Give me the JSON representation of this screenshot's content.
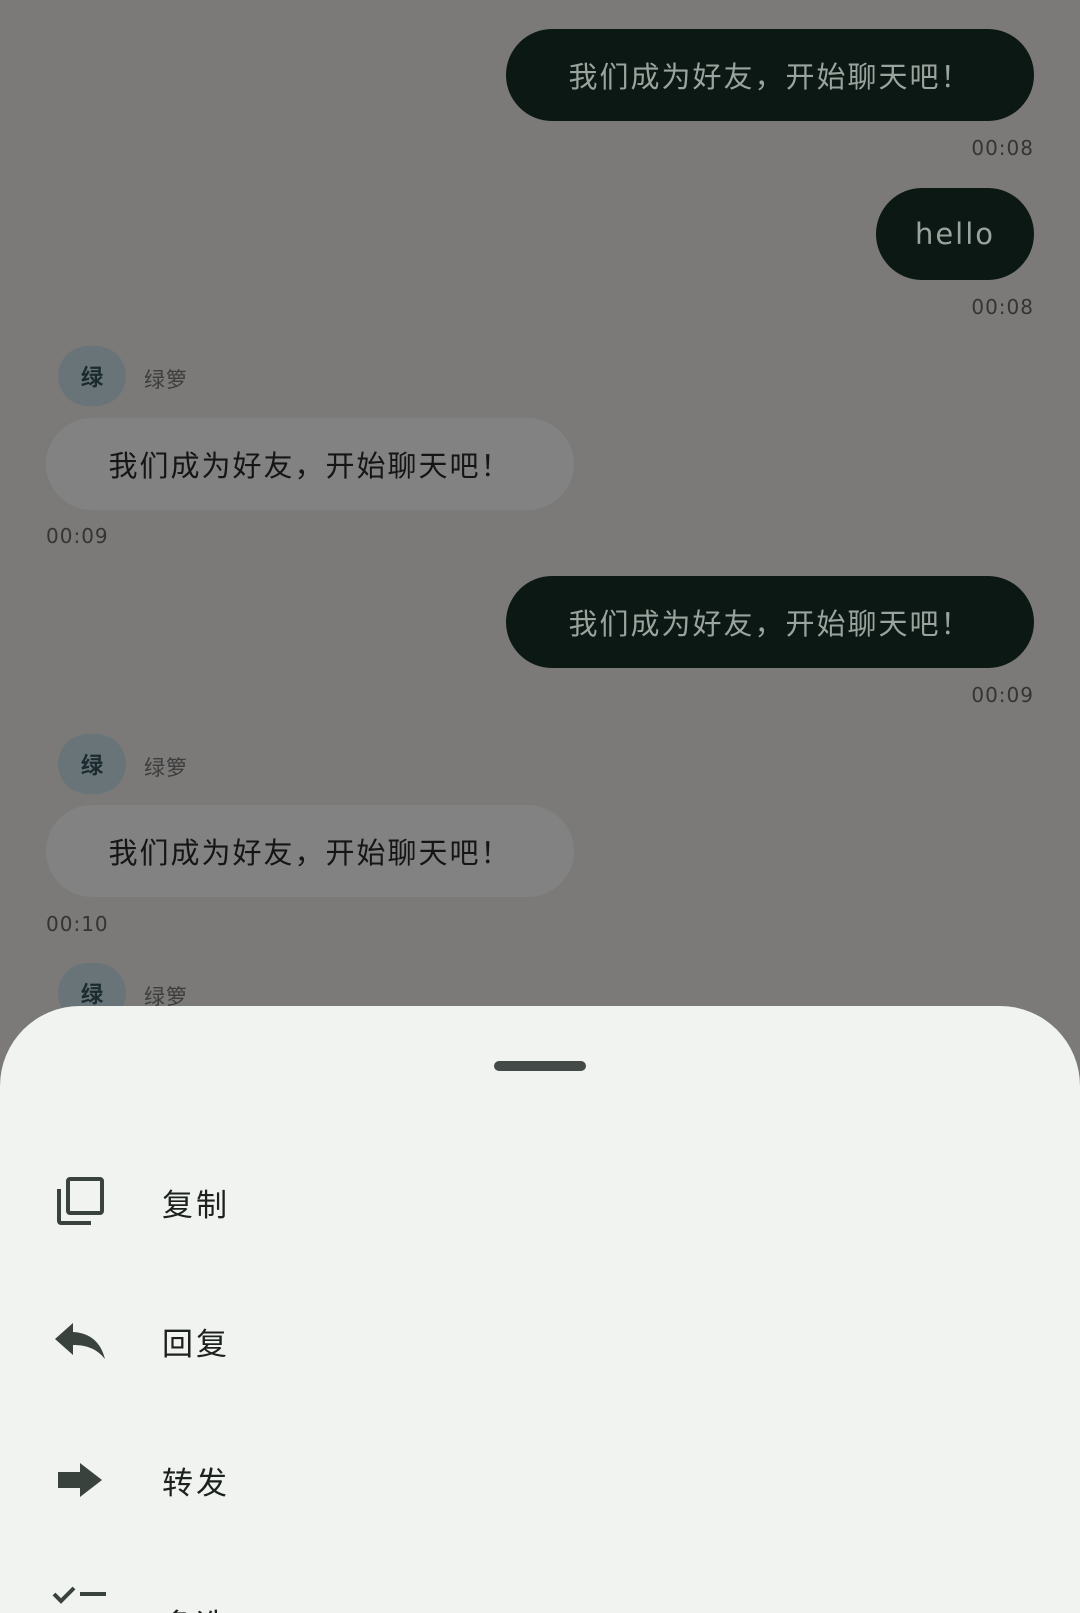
{
  "messages": [
    {
      "direction": "out",
      "text": "我们成为好友，开始聊天吧！",
      "time": "00:08"
    },
    {
      "direction": "out",
      "text": "hello",
      "time": "00:08"
    },
    {
      "direction": "in",
      "avatar": "绿",
      "sender": "绿箩",
      "text": "我们成为好友，开始聊天吧！",
      "time": "00:09"
    },
    {
      "direction": "out",
      "text": "我们成为好友，开始聊天吧！",
      "time": "00:09"
    },
    {
      "direction": "in",
      "avatar": "绿",
      "sender": "绿箩",
      "text": "我们成为好友，开始聊天吧！",
      "time": "00:10"
    },
    {
      "direction": "in",
      "avatar": "绿",
      "sender": "绿箩"
    }
  ],
  "sheet": {
    "items": [
      {
        "label": "复制",
        "icon": "copy-icon"
      },
      {
        "label": "回复",
        "icon": "reply-icon"
      },
      {
        "label": "转发",
        "icon": "forward-icon"
      },
      {
        "label": "多选",
        "icon": "multi-select-icon"
      }
    ]
  },
  "colors": {
    "outgoing_bubble": "#0c1813",
    "incoming_bubble": "#818281",
    "scrim": "#7b7a79",
    "sheet": "#f0f3ef"
  }
}
